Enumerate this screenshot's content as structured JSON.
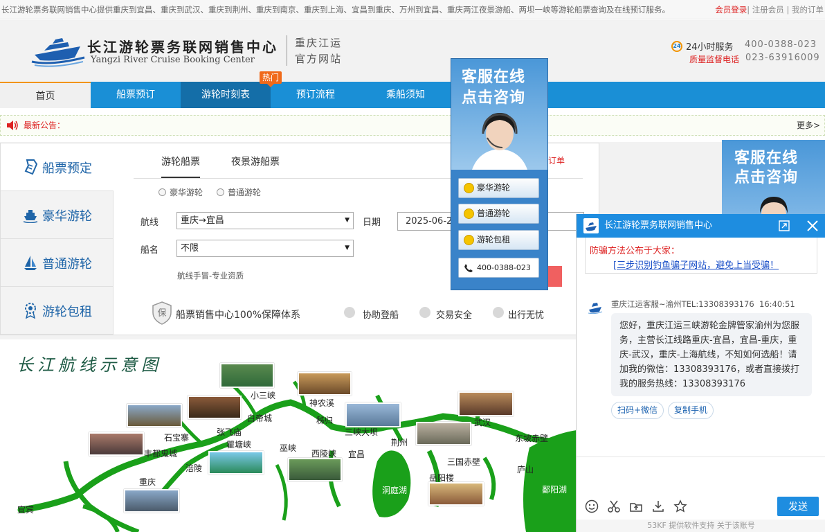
{
  "topbar": {
    "message": "长江游轮票务联网销售中心提供重庆到宜昌、重庆到武汉、重庆到荆州、重庆到南京、重庆到上海、宜昌到重庆、万州到宜昌、重庆两江夜景游船、两坝一峡等游轮船票查询及在线预订服务。",
    "login": "会员登录",
    "links": "| 注册会员 | 我的订单"
  },
  "header": {
    "logo_cn": "长江游轮票务联网销售中心",
    "logo_en": "Yangzi River Cruise Booking Center",
    "sub_line1": "重庆江运",
    "sub_line2": "官方网站",
    "service_label": "24小时服务",
    "supervise_label": "质量监督电话",
    "phone1": "400-0388-023",
    "phone2": "023-63916009",
    "icon24": "24"
  },
  "nav": {
    "items": [
      "首页",
      "船票预订",
      "游轮时刻表",
      "预订流程",
      "乘船须知"
    ],
    "hot_badge": "热门"
  },
  "notice": {
    "label": "最新公告：",
    "more": "更多>"
  },
  "sidebar": {
    "items": [
      "船票预定",
      "豪华游轮",
      "普通游轮",
      "游轮包租"
    ]
  },
  "booking": {
    "tabs": [
      "游轮船票",
      "夜景游船票"
    ],
    "order_link": "订单",
    "radio1": "豪华游轮",
    "radio2": "普通游轮",
    "route_label": "航线",
    "route_value": "重庆→宜昌",
    "ship_label": "船名",
    "ship_value": "不限",
    "date_label": "日期",
    "date_value": "2025-06-22",
    "hint": "航线手冒-专业资质",
    "guarantee_icon": "保",
    "guarantee_main": "船票销售中心100%保障体系",
    "g1": "协助登船",
    "g2": "交易安全",
    "g3": "出行无忧"
  },
  "map": {
    "title": "长江航线示意图",
    "labels": [
      "小三峡",
      "神农溪",
      "白帝城",
      "秭归",
      "三峡大坝",
      "武汉",
      "石宝寨",
      "张飞庙",
      "瞿塘峡",
      "巫峡",
      "西陵峡",
      "荆州",
      "宜昌",
      "东坡赤壁",
      "丰都鬼城",
      "涪陵",
      "重庆",
      "三国赤壁",
      "岳阳楼",
      "洞庭湖",
      "庐山",
      "鄱阳湖",
      "宜宾"
    ]
  },
  "ad_float": {
    "line1": "客服在线",
    "line2": "点击咨询",
    "buttons": [
      "豪华游轮",
      "普通游轮",
      "游轮包租"
    ],
    "tel": "400-0388-023"
  },
  "ad_right": {
    "line1": "客服在线",
    "line2": "点击咨询"
  },
  "chat": {
    "title": "长江游轮票务联网销售中心",
    "scam_line1": "防骗方法公布于大家：",
    "scam_line2": "[三步识别钓鱼骗子网站，避免上当受骗！",
    "agent": "重庆江运客服~渝州TEL:13308393176",
    "time": "16:40:51",
    "message": "您好，重庆江运三峡游轮金牌管家渝州为您服务，主营长江线路重庆-宜昌，宜昌-重庆，重庆-武汉，重庆-上海航线，不知如何选船！请加我的微信：13308393176，或者直接拨打我的服务热线：13308393176",
    "quick1": "扫码+微信",
    "quick2": "复制手机",
    "send": "发送",
    "footer": "53KF 提供软件支持   关于该账号"
  },
  "colors": {
    "nav_blue": "#1a8fd6",
    "nav_active": "#146ea8",
    "accent_orange": "#f06a1a",
    "notice_red": "#dd2222",
    "chat_blue": "#1e8de0"
  }
}
